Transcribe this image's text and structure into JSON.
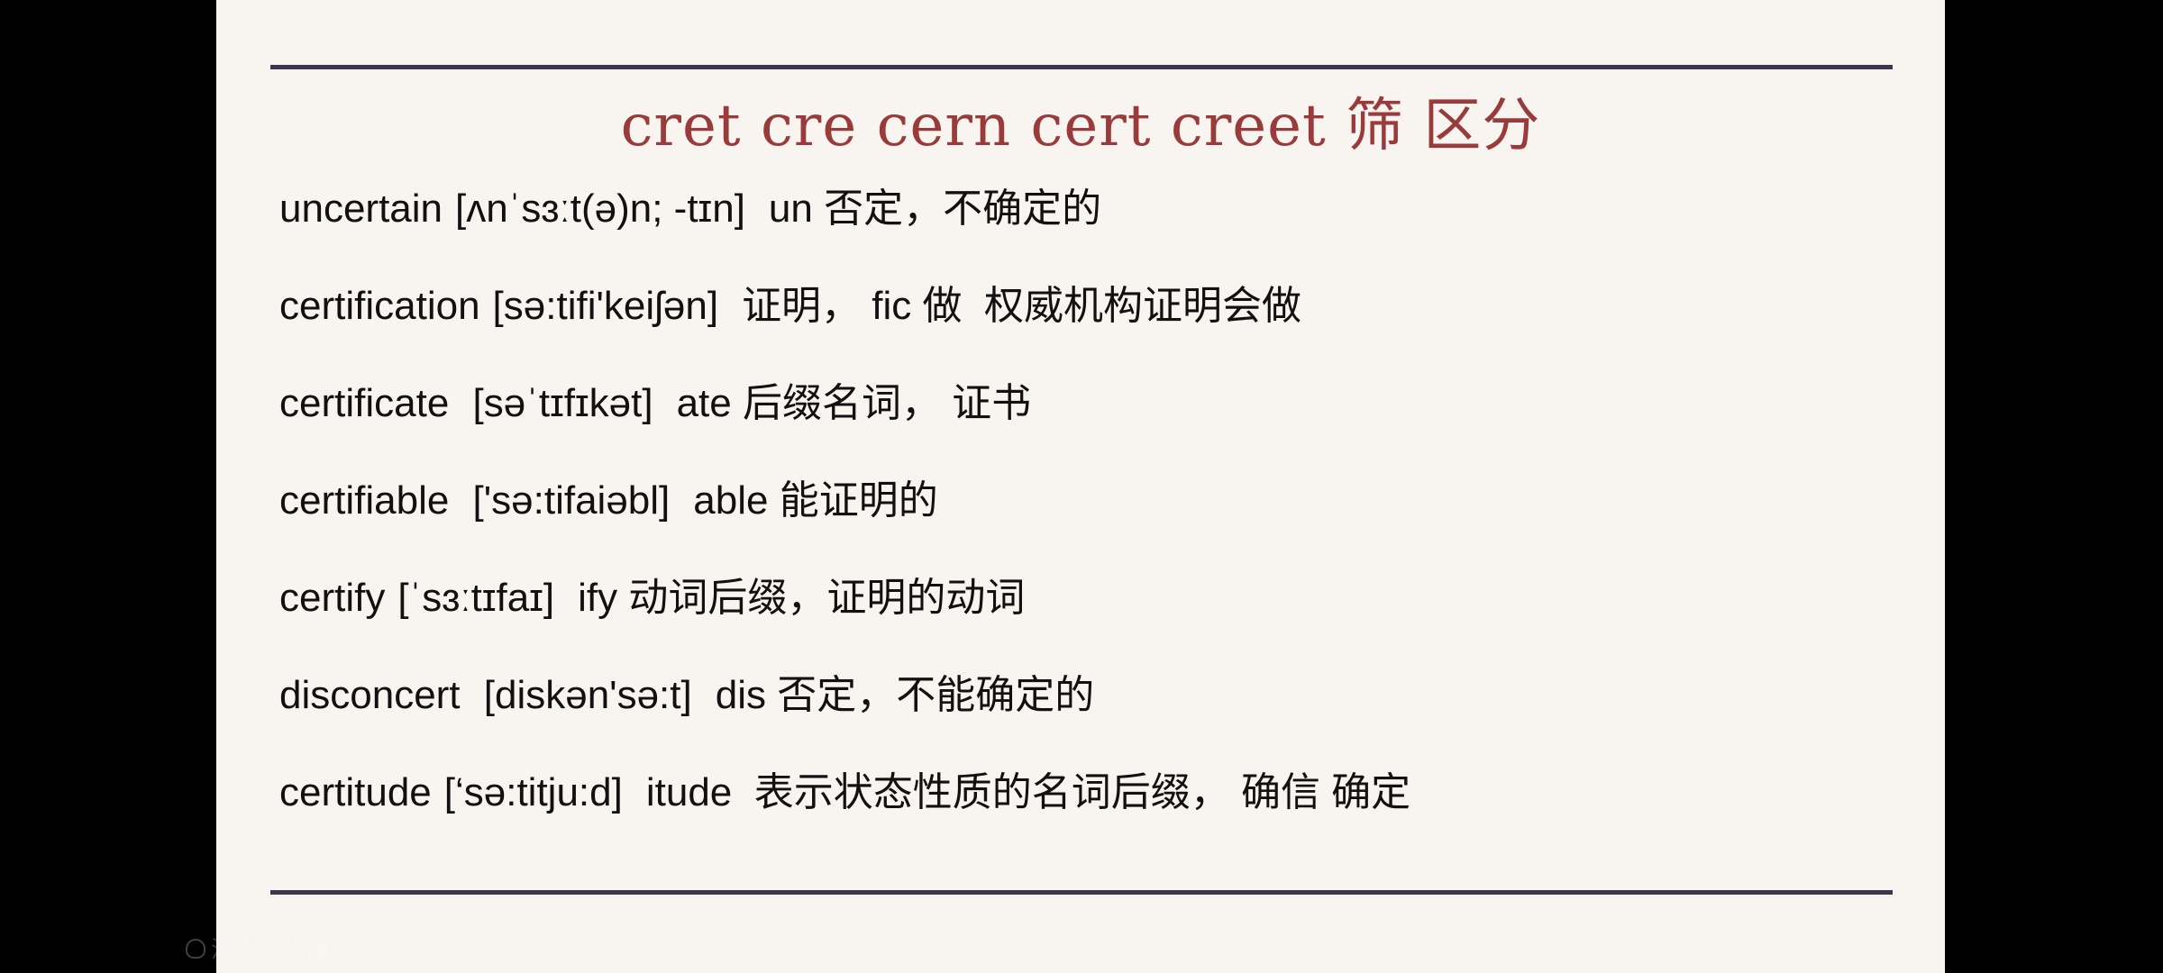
{
  "title": "cret cre cern cert creet 筛 区分",
  "entries": [
    {
      "word": "uncertain",
      "ipa": "[ʌnˈsɜːt(ə)n; -tɪn]",
      "note": "un 否定，不确定的"
    },
    {
      "word": "certification",
      "ipa": "[sə:tifi'keiʃən]",
      "note": "证明， fic 做  权威机构证明会做"
    },
    {
      "word": "certificate",
      "ipa": " [səˈtɪfɪkət]",
      "note": "ate 后缀名词， 证书"
    },
    {
      "word": "certifiable",
      "ipa": " ['sə:tifaiəbl]",
      "note": "able 能证明的"
    },
    {
      "word": "certify",
      "ipa": "[ˈsɜːtɪfaɪ]",
      "note": "ify 动词后缀，证明的动词"
    },
    {
      "word": "disconcert",
      "ipa": " [diskən'sə:t]",
      "note": "dis 否定，不能确定的"
    },
    {
      "word": "certitude",
      "ipa": "[‘sə:titju:d]",
      "note": "itude  表示状态性质的名词后缀， 确信 确定"
    }
  ],
  "watermark": {
    "icon": "watermark-logo-icon",
    "text": "没人比我懂"
  },
  "colors": {
    "title": "#9a3b3b",
    "rule": "#3b3550",
    "slide_bg": "#f8f4f0"
  }
}
